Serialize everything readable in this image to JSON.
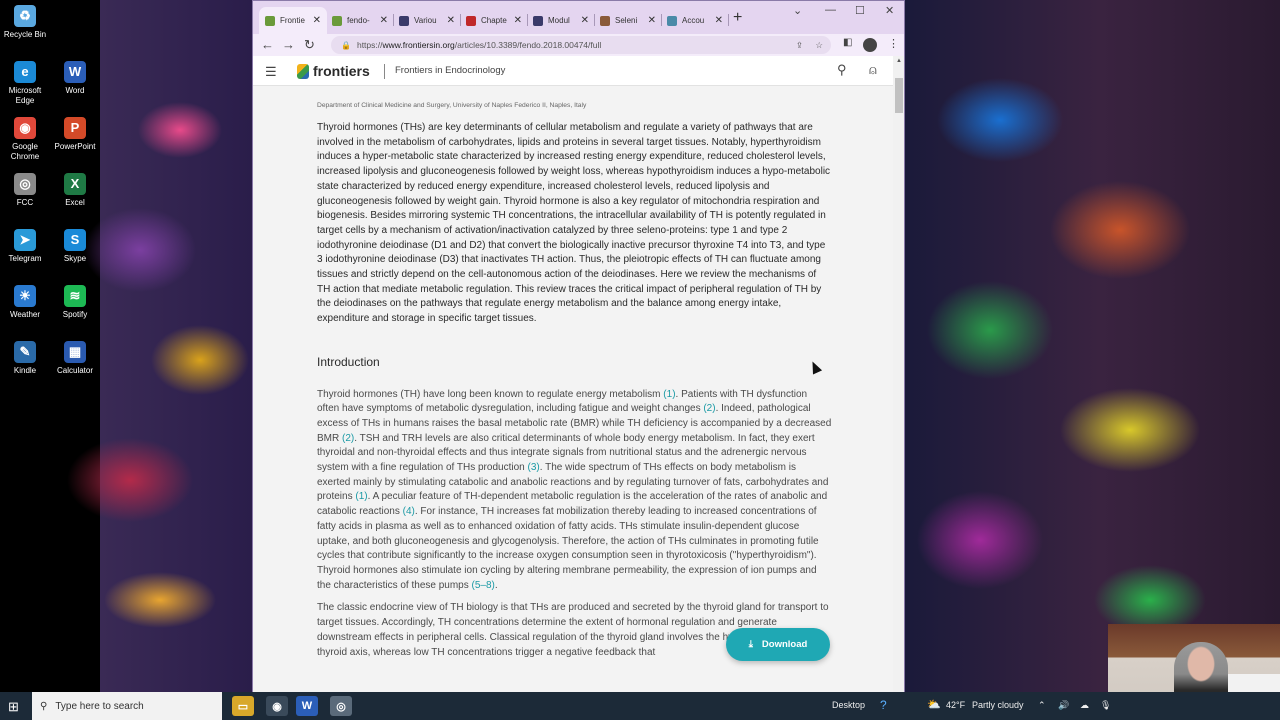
{
  "desktop": {
    "icons": [
      {
        "label": "Recycle Bin",
        "icon": "recycle-bin-icon",
        "color": "#5aa8e0",
        "glyph": "♻"
      },
      {
        "label": "Microsoft Edge",
        "icon": "edge-icon",
        "color": "#1b8ad6",
        "glyph": "e"
      },
      {
        "label": "Word",
        "icon": "word-icon",
        "color": "#2b5eb8",
        "glyph": "W"
      },
      {
        "label": "Google Chrome",
        "icon": "chrome-icon",
        "color": "#e0483a",
        "glyph": "◉"
      },
      {
        "label": "PowerPoint",
        "icon": "powerpoint-icon",
        "color": "#d44a28",
        "glyph": "P"
      },
      {
        "label": "FCC",
        "icon": "fcc-icon",
        "color": "#8a8a8a",
        "glyph": "◎"
      },
      {
        "label": "Excel",
        "icon": "excel-icon",
        "color": "#1f7a45",
        "glyph": "X"
      },
      {
        "label": "Telegram",
        "icon": "telegram-icon",
        "color": "#2a9ad8",
        "glyph": "➤"
      },
      {
        "label": "Skype",
        "icon": "skype-icon",
        "color": "#1a8ad8",
        "glyph": "S"
      },
      {
        "label": "Weather",
        "icon": "weather-icon",
        "color": "#2a7ad0",
        "glyph": "☀"
      },
      {
        "label": "Spotify",
        "icon": "spotify-icon",
        "color": "#1db954",
        "glyph": "≋"
      },
      {
        "label": "Kindle",
        "icon": "kindle-icon",
        "color": "#2a6aa8",
        "glyph": "✎"
      },
      {
        "label": "Calculator",
        "icon": "calculator-icon",
        "color": "#2a5ab0",
        "glyph": "▦"
      }
    ]
  },
  "browser": {
    "tabs": [
      {
        "title": "Frontie",
        "favicon_color": "#6a9a3a",
        "active": true
      },
      {
        "title": "fendo-",
        "favicon_color": "#6a9a3a",
        "active": false
      },
      {
        "title": "Variou",
        "favicon_color": "#3a3a6a",
        "active": false
      },
      {
        "title": "Chapte",
        "favicon_color": "#c0282a",
        "active": false
      },
      {
        "title": "Modul",
        "favicon_color": "#3a3a6a",
        "active": false
      },
      {
        "title": "Seleni",
        "favicon_color": "#8a5a3a",
        "active": false
      },
      {
        "title": "Accou",
        "favicon_color": "#4a8aa8",
        "active": false
      }
    ],
    "new_tab": "+",
    "url_scheme": "https://",
    "url_domain": "www.frontiersin.org",
    "url_path": "/articles/10.3389/fendo.2018.00474/full"
  },
  "site": {
    "logo": "frontiers",
    "journal": "Frontiers in Endocrinology",
    "affiliation": "Department of Clinical Medicine and Surgery, University of Naples Federico II, Naples, Italy",
    "abstract": "Thyroid hormones (THs) are key determinants of cellular metabolism and regulate a variety of pathways that are involved in the metabolism of carbohydrates, lipids and proteins in several target tissues. Notably, hyperthyroidism induces a hyper-metabolic state characterized by increased resting energy expenditure, reduced cholesterol levels, increased lipolysis and gluconeogenesis followed by weight loss, whereas hypothyroidism induces a hypo-metabolic state characterized by reduced energy expenditure, increased cholesterol levels, reduced lipolysis and gluconeogenesis followed by weight gain. Thyroid hormone is also a key regulator of mitochondria respiration and biogenesis. Besides mirroring systemic TH concentrations, the intracellular availability of TH is potently regulated in target cells by a mechanism of activation/inactivation catalyzed by three seleno-proteins: type 1 and type 2 iodothyronine deiodinase (D1 and D2) that convert the biologically inactive precursor thyroxine T4 into T3, and type 3 iodothyronine deiodinase (D3) that inactivates TH action. Thus, the pleiotropic effects of TH can fluctuate among tissues and strictly depend on the cell-autonomous action of the deiodinases. Here we review the mechanisms of TH action that mediate metabolic regulation. This review traces the critical impact of peripheral regulation of TH by the deiodinases on the pathways that regulate energy metabolism and the balance among energy intake, expenditure and storage in specific target tissues.",
    "section_title": "Introduction",
    "intro_p1": [
      "Thyroid hormones (TH) have long been known to regulate energy metabolism ",
      "(1)",
      ". Patients with TH dysfunction often have symptoms of metabolic dysregulation, including fatigue and weight changes ",
      "(2)",
      ". Indeed, pathological excess of THs in humans raises the basal metabolic rate (BMR) while TH deficiency is accompanied by a decreased BMR ",
      "(2)",
      ". TSH and TRH levels are also critical determinants of whole body energy metabolism. In fact, they exert thyroidal and non-thyroidal effects and thus integrate signals from nutritional status and the adrenergic nervous system with a fine regulation of THs production ",
      "(3)",
      ". The wide spectrum of THs effects on body metabolism is exerted mainly by stimulating catabolic and anabolic reactions and by regulating turnover of fats, carbohydrates and proteins ",
      "(1)",
      ". A peculiar feature of TH-dependent metabolic regulation is the acceleration of the rates of anabolic and catabolic reactions ",
      "(4)",
      ". For instance, TH increases fat mobilization thereby leading to increased concentrations of fatty acids in plasma as well as to enhanced oxidation of fatty acids. THs stimulate insulin-dependent glucose uptake, and both gluconeogenesis and glycogenolysis. Therefore, the action of THs culminates in promoting futile cycles that contribute significantly to the increase oxygen consumption seen in thyrotoxicosis (\"hyperthyroidism\"). Thyroid hormones also stimulate ion cycling by altering membrane permeability, the expression of ion pumps and the characteristics of these pumps ",
      "(5–8)",
      "."
    ],
    "intro_p2": "The classic endocrine view of TH biology is that THs are produced and secreted by the thyroid gland for transport to target tissues. Accordingly, TH concentrations determine the extent of hormonal regulation and generate downstream effects in peripheral cells. Classical regulation of the thyroid gland involves the hypothalamic–pituitary–thyroid axis, whereas low TH concentrations trigger a negative feedback that",
    "download_label": "Download"
  },
  "taskbar": {
    "search_placeholder": "Type here to search",
    "desktop_label": "Desktop",
    "weather_temp": "42°F",
    "weather_desc": "Partly cloudy"
  }
}
